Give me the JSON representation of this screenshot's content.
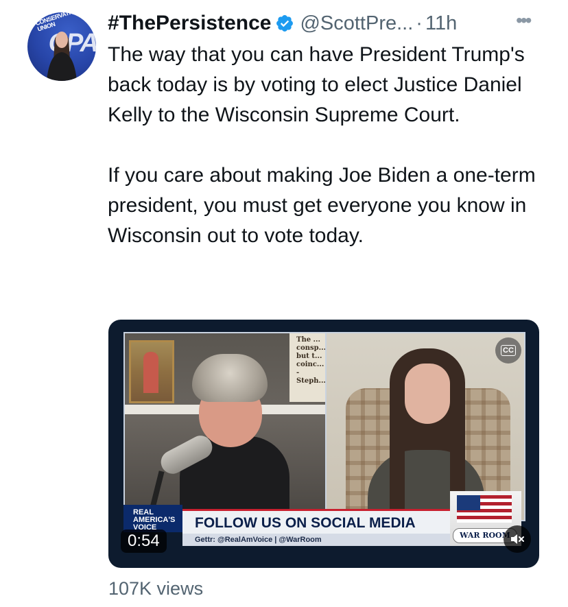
{
  "author": {
    "display_name": "#ThePersistence",
    "handle": "@ScottPre...",
    "separator": "·",
    "time": "11h",
    "avatar_logo_text": "AMERICAN CONSERVATIVE UNION",
    "avatar_logo_mark": "CPA"
  },
  "tweet": {
    "paragraphs": [
      "The way that you can have President Trump's back today is by voting to elect Justice Daniel Kelly to the Wisconsin Supreme Court.",
      "If you care about making Joe Biden a one-term president, you must get everyone you know in Wisconsin out to vote today."
    ]
  },
  "media": {
    "duration": "0:54",
    "cc_label": "CC",
    "overlay": {
      "brand": "REAL AMERICA'S VOICE",
      "headline": "FOLLOW US ON SOCIAL MEDIA",
      "subline": "Gettr: @RealAmVoice | @WarRoom",
      "show_logo": "WAR ROOM",
      "sign_text": "The ... consp... but t... coinc... -Steph..."
    }
  },
  "stats": {
    "views": "107K views"
  },
  "icons": {
    "verified": "verified-badge-icon",
    "more": "more-options-icon",
    "mute": "muted-speaker-icon",
    "cc": "closed-captions-icon"
  },
  "colors": {
    "text": "#0f1419",
    "secondary": "#536471",
    "verified_blue": "#1d9bf0"
  }
}
